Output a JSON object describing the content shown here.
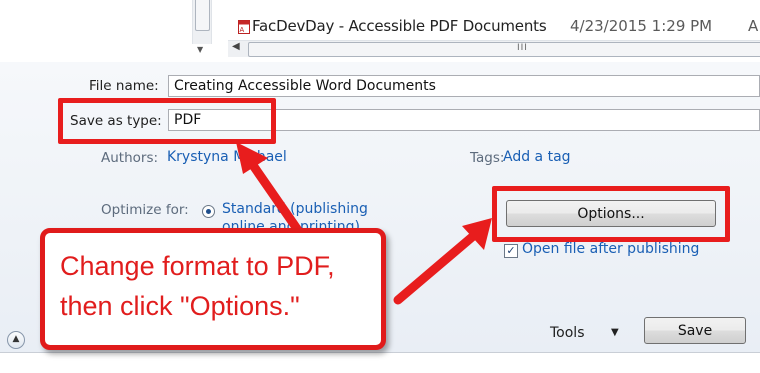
{
  "file_list": {
    "file_name": "FacDevDay - Accessible PDF Documents",
    "file_date": "4/23/2015 1:29 PM",
    "file_trunc": "A",
    "scroll_grip": "III"
  },
  "form": {
    "file_name_label": "File name:",
    "file_name_value": "Creating Accessible Word Documents",
    "save_as_type_label": "Save as type:",
    "save_as_type_value": "PDF",
    "authors_label": "Authors:",
    "authors_value": "Krystyna Michael",
    "tags_label": "Tags:",
    "tags_value": "Add a tag",
    "optimize_label": "Optimize for:",
    "optimize_standard_line1": "Standard (publishing",
    "optimize_standard_line2": "online and printing)",
    "options_button": "Options...",
    "open_after_label": "Open file after publishing",
    "tools_label": "Tools",
    "save_button": "Save"
  },
  "callout": {
    "line1": "Change format to PDF,",
    "line2": "then click \"Options.\""
  },
  "colors": {
    "highlight": "#e81d1d",
    "link": "#1a5fb4"
  }
}
